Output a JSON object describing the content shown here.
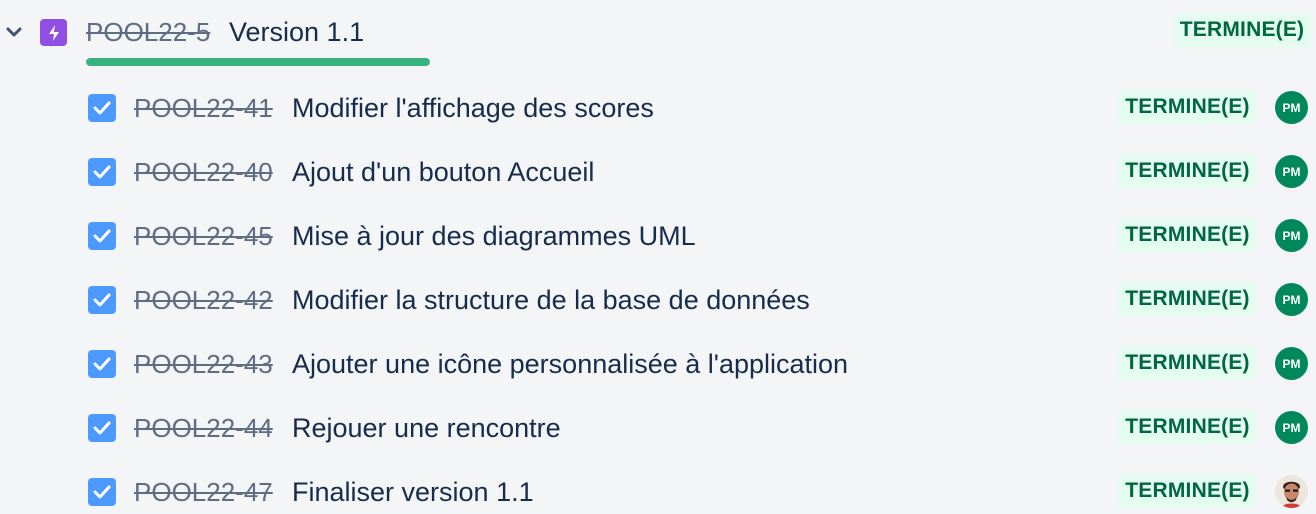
{
  "colors": {
    "epic_purple": "#904ee2",
    "progress_green": "#36b37e",
    "status_bg": "#e3fcef",
    "status_text": "#006644",
    "checkbox_blue": "#4c9aff",
    "avatar_green": "#00875a"
  },
  "epic": {
    "toggle_icon": "chevron-down-icon",
    "type_icon": "epic-lightning-icon",
    "key": "POOL22-5",
    "title": "Version 1.1",
    "status": "TERMINE(E)",
    "progress_done_fraction": 1.0
  },
  "issues": [
    {
      "key": "POOL22-41",
      "summary": "Modifier l'affichage des scores",
      "status": "TERMINE(E)",
      "assignee": "PM",
      "avatar_type": "initials"
    },
    {
      "key": "POOL22-40",
      "summary": "Ajout d'un bouton Accueil",
      "status": "TERMINE(E)",
      "assignee": "PM",
      "avatar_type": "initials"
    },
    {
      "key": "POOL22-45",
      "summary": "Mise à jour des diagrammes UML",
      "status": "TERMINE(E)",
      "assignee": "PM",
      "avatar_type": "initials"
    },
    {
      "key": "POOL22-42",
      "summary": "Modifier la structure de la base de données",
      "status": "TERMINE(E)",
      "assignee": "PM",
      "avatar_type": "initials"
    },
    {
      "key": "POOL22-43",
      "summary": "Ajouter une icône personnalisée à l'application",
      "status": "TERMINE(E)",
      "assignee": "PM",
      "avatar_type": "initials"
    },
    {
      "key": "POOL22-44",
      "summary": "Rejouer une rencontre",
      "status": "TERMINE(E)",
      "assignee": "PM",
      "avatar_type": "initials"
    },
    {
      "key": "POOL22-47",
      "summary": "Finaliser version 1.1",
      "status": "TERMINE(E)",
      "assignee": "",
      "avatar_type": "photo"
    }
  ]
}
